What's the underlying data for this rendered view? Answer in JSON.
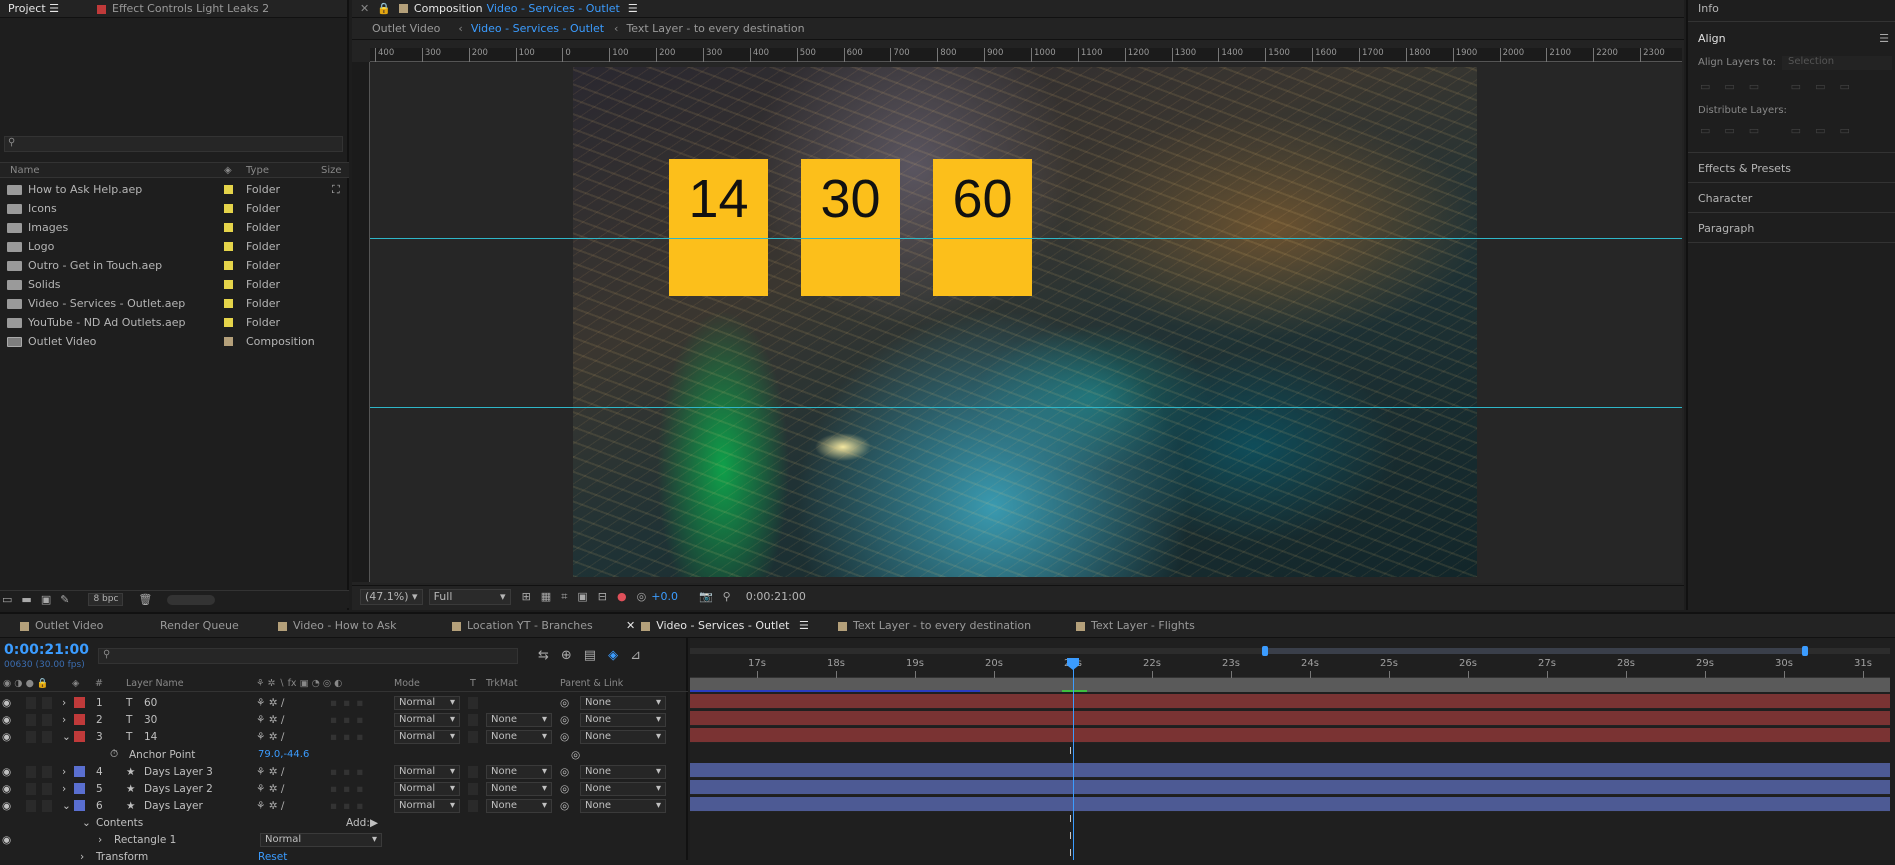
{
  "project": {
    "tab_label": "Project",
    "effect_controls_label": "Effect Controls",
    "effect_controls_layer": "Light Leaks 2",
    "columns": {
      "name": "Name",
      "type": "Type",
      "size": "Size"
    },
    "items": [
      {
        "name": "How to Ask Help.aep",
        "type": "Folder",
        "label_color": "#e5d44a"
      },
      {
        "name": "Icons",
        "type": "Folder",
        "label_color": "#e5d44a"
      },
      {
        "name": "Images",
        "type": "Folder",
        "label_color": "#e5d44a"
      },
      {
        "name": "Logo",
        "type": "Folder",
        "label_color": "#e5d44a"
      },
      {
        "name": "Outro - Get in Touch.aep",
        "type": "Folder",
        "label_color": "#e5d44a"
      },
      {
        "name": "Solids",
        "type": "Folder",
        "label_color": "#e5d44a"
      },
      {
        "name": "Video - Services - Outlet.aep",
        "type": "Folder",
        "label_color": "#e5d44a"
      },
      {
        "name": "YouTube - ND Ad Outlets.aep",
        "type": "Folder",
        "label_color": "#e5d44a"
      },
      {
        "name": "Outlet Video",
        "type": "Composition",
        "label_color": "#b4a07a"
      }
    ],
    "bpc": "8 bpc"
  },
  "composition": {
    "prefix": "Composition",
    "name": "Video - Services - Outlet",
    "breadcrumbs": [
      "Outlet Video",
      "Video - Services - Outlet",
      "Text Layer - to every destination"
    ],
    "ruler_ticks": [
      "400",
      "300",
      "200",
      "100",
      "0",
      "100",
      "200",
      "300",
      "400",
      "500",
      "600",
      "700",
      "800",
      "900",
      "1000",
      "1100",
      "1200",
      "1300",
      "1400",
      "1500",
      "1600",
      "1700",
      "1800",
      "1900",
      "2000",
      "2100",
      "2200",
      "2300"
    ],
    "boxes": [
      "14",
      "30",
      "60"
    ],
    "box_color": "#fcbf1b",
    "zoom": "(47.1%)",
    "resolution": "Full",
    "exposure": "+0.0",
    "timecode": "0:00:21:00"
  },
  "right_panel": {
    "info": "Info",
    "align": "Align",
    "align_layers_to": "Align Layers to:",
    "align_target": "Selection",
    "distribute": "Distribute Layers:",
    "effects": "Effects & Presets",
    "character": "Character",
    "paragraph": "Paragraph"
  },
  "timeline": {
    "tabs": [
      {
        "label": "Outlet Video",
        "color": "#b4a07a"
      },
      {
        "label": "Render Queue",
        "color": ""
      },
      {
        "label": "Video - How to Ask",
        "color": "#b4a07a"
      },
      {
        "label": "Location YT - Branches",
        "color": "#b4a07a"
      },
      {
        "label": "Video - Services - Outlet",
        "color": "#b4a07a"
      },
      {
        "label": "Text Layer - to every destination",
        "color": "#b4a07a"
      },
      {
        "label": "Text Layer - Flights",
        "color": "#b4a07a"
      }
    ],
    "current_time": "0:00:21:00",
    "frame_info": "00630 (30.00 fps)",
    "col_headers": {
      "num": "#",
      "layer_name": "Layer Name",
      "mode": "Mode",
      "t": "T",
      "trkmat": "TrkMat",
      "parent": "Parent & Link"
    },
    "time_labels": [
      "17s",
      "18s",
      "19s",
      "20s",
      "21s",
      "22s",
      "23s",
      "24s",
      "25s",
      "26s",
      "27s",
      "28s",
      "29s",
      "30s",
      "31s"
    ],
    "layers": [
      {
        "num": "1",
        "kind": "T",
        "name": "60",
        "mode": "Normal",
        "trkmat": "",
        "parent": "None",
        "color": "#c03a3a"
      },
      {
        "num": "2",
        "kind": "T",
        "name": "30",
        "mode": "Normal",
        "trkmat": "None",
        "parent": "None",
        "color": "#c03a3a"
      },
      {
        "num": "3",
        "kind": "T",
        "name": "14",
        "mode": "Normal",
        "trkmat": "None",
        "parent": "None",
        "color": "#c03a3a"
      },
      {
        "num": "4",
        "kind": "★",
        "name": "Days Layer 3",
        "mode": "Normal",
        "trkmat": "None",
        "parent": "None",
        "color": "#5a6fd0"
      },
      {
        "num": "5",
        "kind": "★",
        "name": "Days Layer 2",
        "mode": "Normal",
        "trkmat": "None",
        "parent": "None",
        "color": "#5a6fd0"
      },
      {
        "num": "6",
        "kind": "★",
        "name": "Days Layer",
        "mode": "Normal",
        "trkmat": "None",
        "parent": "None",
        "color": "#5a6fd0"
      }
    ],
    "anchor_point_label": "Anchor Point",
    "anchor_point_value": "79.0,-44.6",
    "contents_label": "Contents",
    "add_label": "Add:",
    "rectangle_label": "Rectangle 1",
    "rectangle_mode": "Normal",
    "transform_label": "Transform",
    "reset_label": "Reset",
    "red_bar_color": "#7a3333",
    "blue_bar_color": "#4d5a94"
  }
}
